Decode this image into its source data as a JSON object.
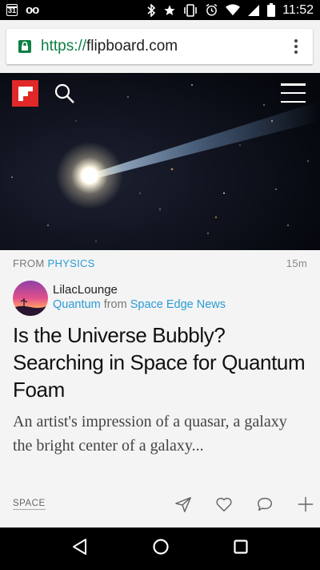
{
  "status_bar": {
    "calendar_day": "31",
    "voicemail_icon": "voicemail-icon",
    "time": "11:52",
    "icons": [
      "bluetooth-icon",
      "star-icon",
      "vibrate-icon",
      "alarm-icon",
      "wifi-icon",
      "signal-icon",
      "battery-icon"
    ]
  },
  "browser": {
    "url_scheme": "https://",
    "url_host": "flipboard.com",
    "secure": true
  },
  "hero": {
    "logo": "flipboard-logo",
    "search_icon": "search-icon",
    "menu_icon": "menu-icon"
  },
  "article": {
    "from_label": "FROM",
    "topic": "PHYSICS",
    "age": "15m",
    "author_name": "LilacLounge",
    "magazine": "Quantum",
    "from_word": "from",
    "source": "Space Edge News",
    "headline": "Is the Universe Bubbly? Searching in Space for Quantum Foam",
    "excerpt": "An artist's impression of a quasar, a galaxy the bright center of a galaxy...",
    "tag": "SPACE"
  },
  "actions": [
    "share-icon",
    "like-icon",
    "comment-icon",
    "add-icon"
  ],
  "nav": [
    "back-icon",
    "home-icon",
    "recents-icon"
  ],
  "colors": {
    "accent_blue": "#2a9bd6",
    "flipboard_red": "#e12828",
    "secure_green": "#0b8043"
  }
}
